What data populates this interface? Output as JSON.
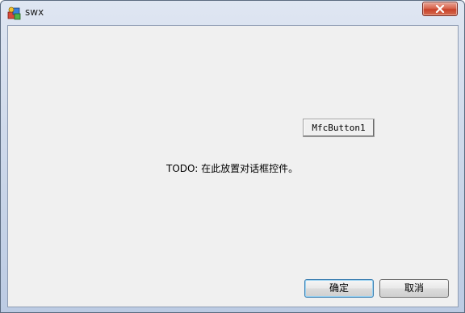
{
  "window": {
    "title": "swx",
    "close_icon": "close-icon",
    "app_icon": "app-icon"
  },
  "dialog": {
    "todo_text": "TODO: 在此放置对话框控件。",
    "mfc_button_label": "MfcButton1",
    "ok_label": "确定",
    "cancel_label": "取消"
  },
  "colors": {
    "close_button": "#c8422a",
    "dialog_background": "#f0f0f0",
    "default_button_border": "#3c7fb1"
  }
}
